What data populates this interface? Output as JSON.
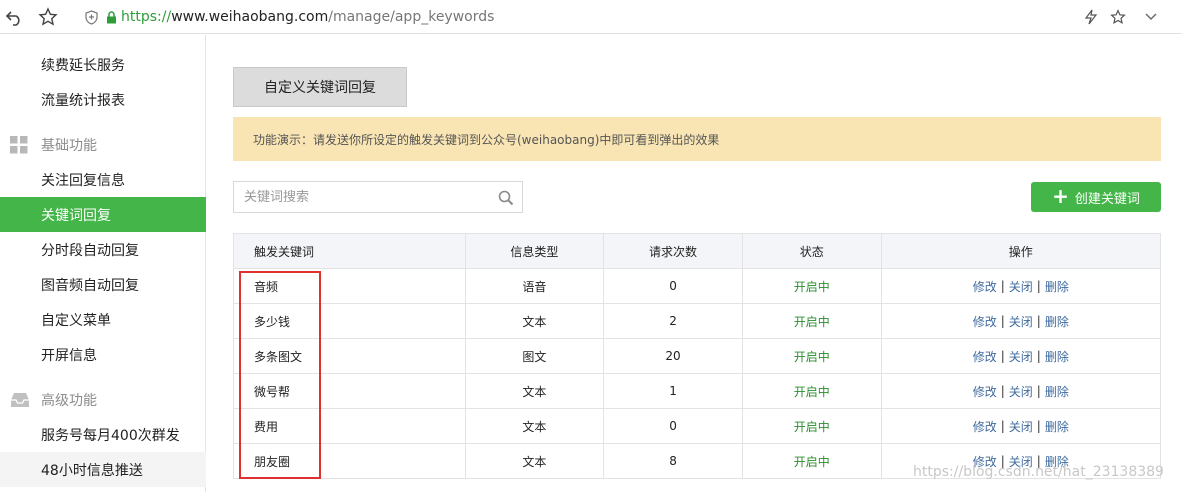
{
  "browser": {
    "url_scheme": "https://",
    "url_host": "www.weihaobang.com",
    "url_path": "/manage/app_keywords"
  },
  "sidebar": {
    "items_top": [
      {
        "label": "续费延长服务"
      },
      {
        "label": "流量统计报表"
      }
    ],
    "group_basic": {
      "label": "基础功能",
      "icon": "grid-icon"
    },
    "items_basic": [
      {
        "label": "关注回复信息"
      },
      {
        "label": "关键词回复",
        "active": true
      },
      {
        "label": "分时段自动回复"
      },
      {
        "label": "图音频自动回复"
      },
      {
        "label": "自定义菜单"
      },
      {
        "label": "开屏信息"
      }
    ],
    "group_advanced": {
      "label": "高级功能",
      "icon": "inbox-icon"
    },
    "items_advanced": [
      {
        "label": "服务号每月400次群发"
      },
      {
        "label": "48小时信息推送"
      }
    ]
  },
  "main": {
    "tab_label": "自定义关键词回复",
    "notice": "功能演示：请发送你所设定的触发关键词到公众号(weihaobang)中即可看到弹出的效果",
    "search_placeholder": "关键词搜索",
    "create_label": "创建关键词",
    "table": {
      "headers": [
        "触发关键词",
        "信息类型",
        "请求次数",
        "状态",
        "操作"
      ],
      "rows": [
        {
          "keyword": "音频",
          "type": "语音",
          "count": "0",
          "status": "开启中"
        },
        {
          "keyword": "多少钱",
          "type": "文本",
          "count": "2",
          "status": "开启中"
        },
        {
          "keyword": "多条图文",
          "type": "图文",
          "count": "20",
          "status": "开启中"
        },
        {
          "keyword": "微号帮",
          "type": "文本",
          "count": "1",
          "status": "开启中"
        },
        {
          "keyword": "费用",
          "type": "文本",
          "count": "0",
          "status": "开启中"
        },
        {
          "keyword": "朋友圈",
          "type": "文本",
          "count": "8",
          "status": "开启中"
        }
      ],
      "actions": {
        "edit": "修改",
        "close": "关闭",
        "delete": "删除",
        "sep": "|"
      }
    }
  },
  "watermark": "https://blog.csdn.net/hat_23138389",
  "colors": {
    "accent": "#44b549",
    "notice_bg": "#f9e5b3",
    "status": "#2a8f2e",
    "link": "#3f6b9e",
    "highlight": "#e03131"
  }
}
